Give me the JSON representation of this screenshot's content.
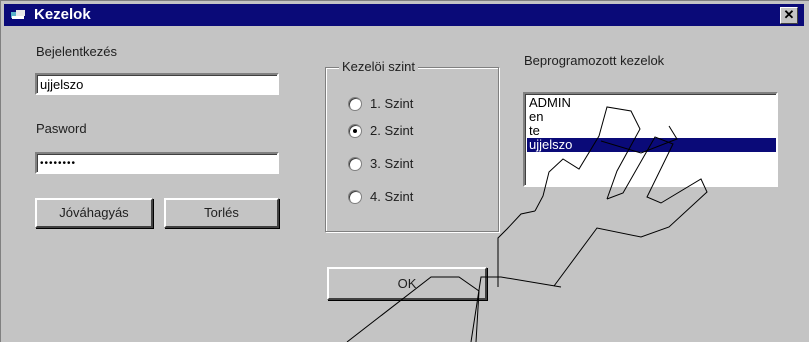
{
  "window": {
    "title": "Kezelok",
    "close_glyph": "✕",
    "title_icon": "app-icon"
  },
  "login": {
    "username_label": "Bejelentkezés",
    "username_value": "ujjelszo",
    "password_label": "Pasword",
    "password_value": "••••••••",
    "confirm_button": "Jóváhagyás",
    "delete_button": "Torlés"
  },
  "level_group": {
    "legend": "Kezelöi szint",
    "options": [
      {
        "label": "1. Szint",
        "selected": false
      },
      {
        "label": "2. Szint",
        "selected": true
      },
      {
        "label": "3. Szint",
        "selected": false
      },
      {
        "label": "4. Szint",
        "selected": false
      }
    ]
  },
  "ok_button": "OK",
  "operators": {
    "label": "Beprogramozott kezelok",
    "items": [
      "ADMIN",
      "en",
      "te",
      "ujjelszo"
    ],
    "selected_index": 3
  },
  "colors": {
    "titlebar": "#0a0a78",
    "face": "#c4c4c4",
    "selection": "#0a0a78"
  }
}
